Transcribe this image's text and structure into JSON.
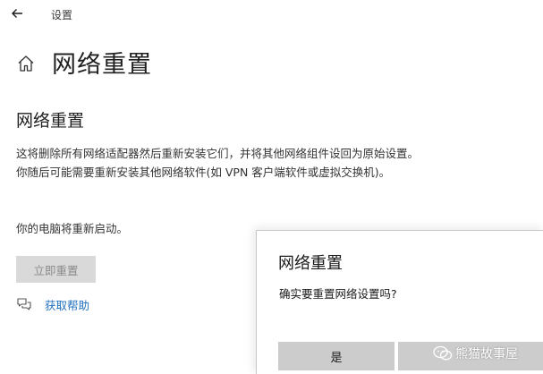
{
  "window": {
    "title": "设置",
    "back_icon": "back-arrow-icon"
  },
  "header": {
    "home_icon": "home-icon",
    "title": "网络重置"
  },
  "section": {
    "title": "网络重置",
    "description": "这将删除所有网络适配器然后重新安装它们，并将其他网络组件设回为原始设置。你随后可能需要重新安装其他网络软件(如 VPN 客户端软件或虚拟交换机)。",
    "restart_note": "你的电脑将重新启动。",
    "reset_button_label": "立即重置",
    "reset_button_state": "disabled",
    "help_icon": "chat-help-icon",
    "help_link": "获取帮助"
  },
  "dialog": {
    "title": "网络重置",
    "message": "确实要重置网络设置吗?",
    "yes_label": "是",
    "no_label": ""
  },
  "watermark": {
    "text": "熊猫故事屋",
    "icon": "wechat-icon"
  },
  "colors": {
    "link": "#1f6fbf",
    "button_bg": "#cccccc",
    "disabled_button_bg": "#d9d9d9",
    "disabled_text": "#8a8a8a"
  }
}
